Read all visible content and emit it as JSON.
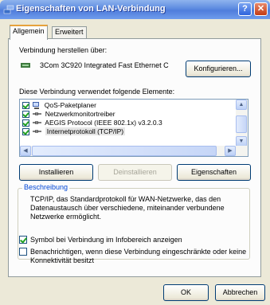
{
  "window": {
    "title": "Eigenschaften von LAN-Verbindung",
    "help_label": "?",
    "close_label": "✕"
  },
  "tabs": [
    {
      "label": "Allgemein",
      "active": true
    },
    {
      "label": "Erweitert",
      "active": false
    }
  ],
  "connection": {
    "heading": "Verbindung herstellen über:",
    "adapter": "3Com 3C920 Integrated Fast Ethernet C",
    "configure_label": "Konfigurieren..."
  },
  "elements": {
    "heading": "Diese Verbindung verwendet folgende Elemente:",
    "items": [
      {
        "label": "QoS-Paketplaner",
        "checked": true,
        "icon": "scheduler-icon",
        "selected": false
      },
      {
        "label": "Netzwerkmonitortreiber",
        "checked": true,
        "icon": "protocol-icon",
        "selected": false
      },
      {
        "label": "AEGIS Protocol (IEEE 802.1x) v3.2.0.3",
        "checked": true,
        "icon": "protocol-icon",
        "selected": false
      },
      {
        "label": "Internetprotokoll (TCP/IP)",
        "checked": true,
        "icon": "protocol-icon",
        "selected": true
      }
    ]
  },
  "buttons": {
    "install": "Installieren",
    "uninstall": "Deinstallieren",
    "properties": "Eigenschaften",
    "ok": "OK",
    "cancel": "Abbrechen"
  },
  "description": {
    "legend": "Beschreibung",
    "text": "TCP/IP, das Standardprotokoll für WAN-Netzwerke, das den Datenaustausch über verschiedene, miteinander verbundene Netzwerke ermöglicht."
  },
  "options": [
    {
      "label": "Symbol bei Verbindung im Infobereich anzeigen",
      "checked": true
    },
    {
      "label": "Benachrichtigen, wenn diese Verbindung eingeschränkte oder keine Konnektivität besitzt",
      "checked": false
    }
  ],
  "colors": {
    "title_bar": "#4f7ddc",
    "dialog_bg": "#ece9d8",
    "accent_tab": "#e6a23c",
    "legend": "#0046d5"
  }
}
